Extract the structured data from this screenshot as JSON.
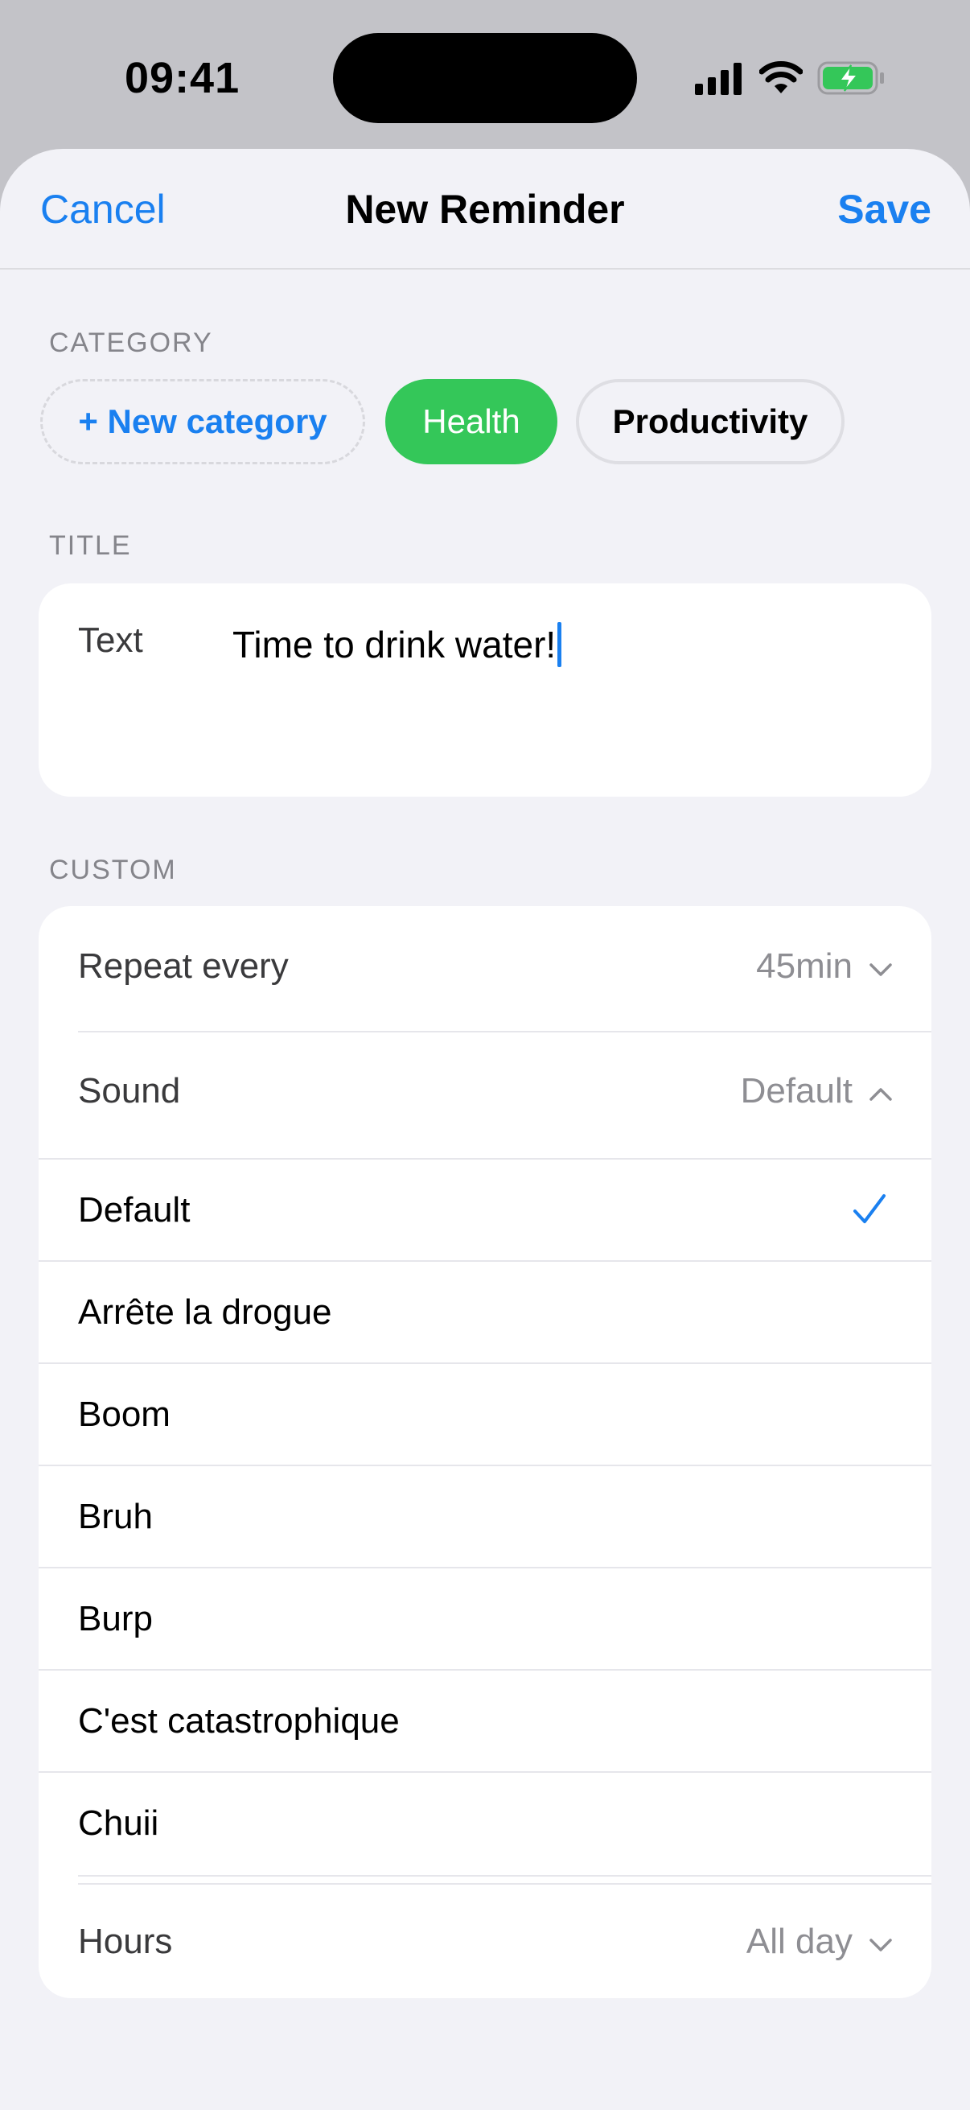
{
  "status_bar": {
    "time": "09:41"
  },
  "nav": {
    "cancel": "Cancel",
    "title": "New Reminder",
    "save": "Save"
  },
  "category": {
    "label": "CATEGORY",
    "chips": {
      "new": "+ New category",
      "health": "Health",
      "productivity": "Productivity"
    },
    "selected": "Health"
  },
  "title_section": {
    "label": "TITLE",
    "field_label": "Text",
    "value": "Time to drink water!"
  },
  "custom": {
    "label": "CUSTOM",
    "repeat": {
      "label": "Repeat every",
      "value": "45min"
    },
    "sound": {
      "label": "Sound",
      "value": "Default"
    },
    "sound_options": [
      {
        "label": "Default",
        "selected": true
      },
      {
        "label": "Arrête la drogue",
        "selected": false
      },
      {
        "label": "Boom",
        "selected": false
      },
      {
        "label": "Bruh",
        "selected": false
      },
      {
        "label": "Burp",
        "selected": false
      },
      {
        "label": "C'est catastrophique",
        "selected": false
      },
      {
        "label": "Chuii",
        "selected": false
      }
    ],
    "hours": {
      "label": "Hours",
      "value": "All day"
    }
  },
  "colors": {
    "accent": "#1a80f0",
    "health_chip": "#34c759",
    "background": "#f2f2f7"
  }
}
